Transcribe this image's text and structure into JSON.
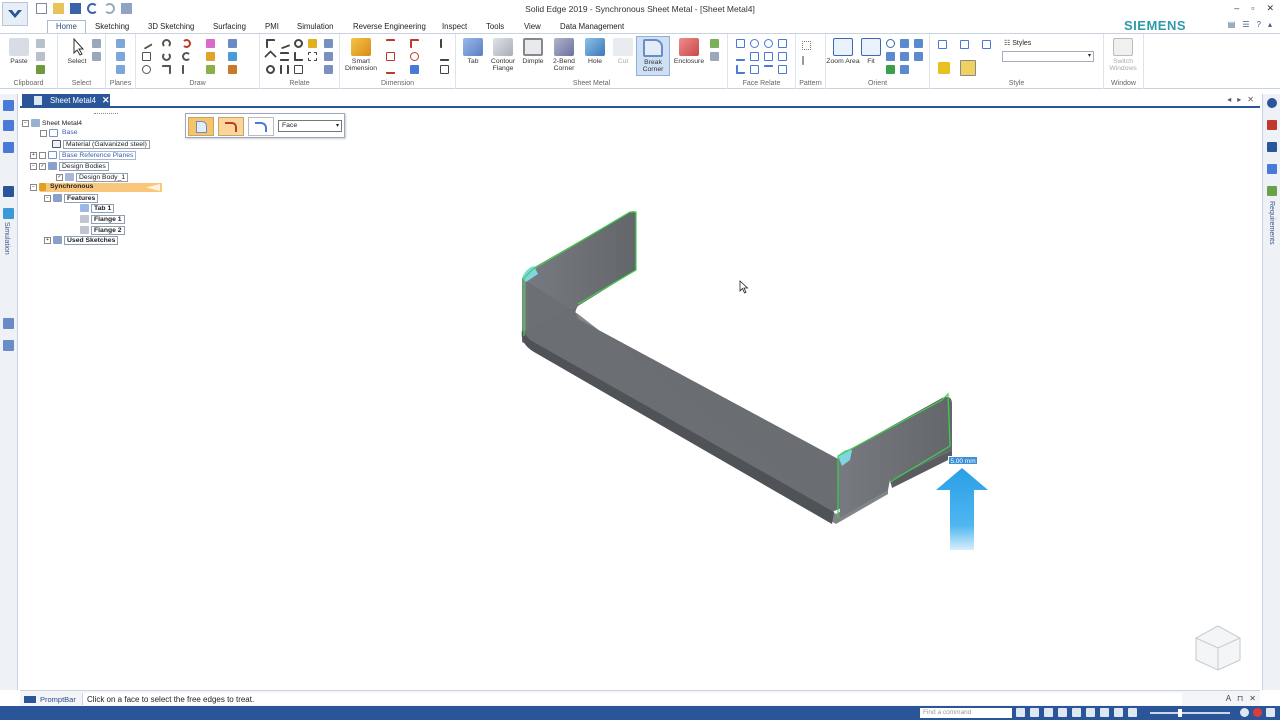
{
  "window": {
    "title": "Solid Edge 2019 - Synchronous Sheet Metal - [Sheet Metal4]",
    "controls": [
      "–",
      "▫",
      "✕"
    ]
  },
  "tabs": [
    "Home",
    "Sketching",
    "3D Sketching",
    "Surfacing",
    "PMI",
    "Simulation",
    "Reverse Engineering",
    "Inspect",
    "Tools",
    "View",
    "Data Management"
  ],
  "brand": "SIEMENS",
  "ribbon": {
    "groups": {
      "clipboard": "Clipboard",
      "select": "Select",
      "planes": "Planes",
      "draw": "Draw",
      "relate": "Relate",
      "dimension": "Dimension",
      "sheet_metal": "Sheet Metal",
      "face_relate": "Face Relate",
      "pattern": "Pattern",
      "orient": "Orient",
      "style": "Style",
      "window": "Window"
    },
    "buttons": {
      "paste": "Paste",
      "select": "Select",
      "smart_dimension": "Smart Dimension",
      "tab": "Tab",
      "contour_flange": "Contour Flange",
      "dimple": "Dimple",
      "two_bend_corner": "2-Bend Corner",
      "hole": "Hole",
      "cut": "Cut",
      "break_corner": "Break Corner",
      "enclosure": "Enclosure",
      "zoom_area": "Zoom Area",
      "fit": "Fit",
      "styles": "Styles",
      "switch_windows": "Switch Windows"
    }
  },
  "document": {
    "tab_label": "Sheet Metal4"
  },
  "command_bar": {
    "select_filter": "Face"
  },
  "tree": {
    "root": "Sheet Metal4",
    "base": "Base",
    "material": "Material (Galvanized steel)",
    "base_reference_planes": "Base Reference Planes",
    "design_bodies": "Design Bodies",
    "design_body_1": "Design Body_1",
    "synchronous": "Synchronous",
    "features": "Features",
    "tab_1": "Tab 1",
    "flange_1": "Flange 1",
    "flange_2": "Flange 2",
    "used_sketches": "Used Sketches"
  },
  "side_panels": {
    "left": "Simulation",
    "right": "Requirements"
  },
  "viewport": {
    "dimension_value": "5.00 mm",
    "part_color": "#6a6d72",
    "edge_highlight": "#3fd04a",
    "arrow_color": "#2a9fe6"
  },
  "prompt": {
    "label": "PromptBar",
    "text": "Click on a face to select the free edges to treat."
  },
  "status": {
    "find_placeholder": "Find a command"
  }
}
